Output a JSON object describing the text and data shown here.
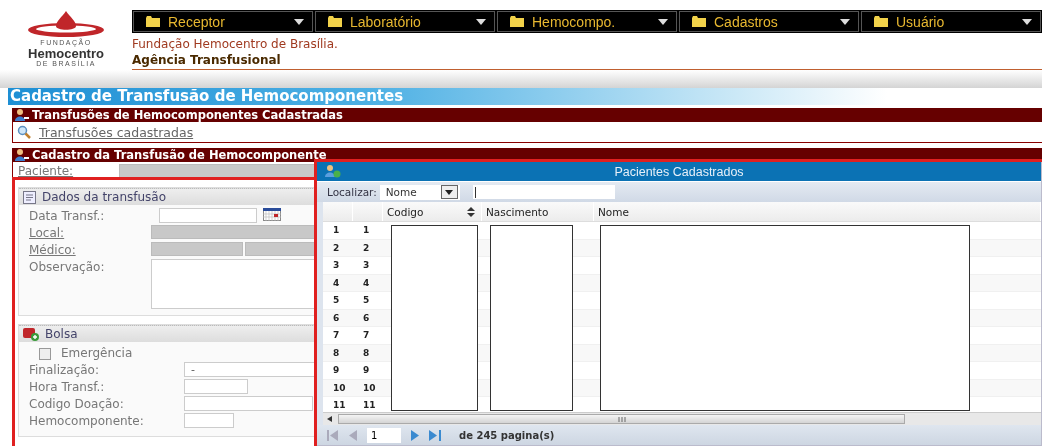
{
  "logo": {
    "top": "FUNDAÇÃO",
    "name": "Hemocentro",
    "bottom": "DE BRASÍLIA"
  },
  "menu": [
    {
      "label": "Receptor"
    },
    {
      "label": "Laboratório"
    },
    {
      "label": "Hemocompo."
    },
    {
      "label": "Cadastros"
    },
    {
      "label": "Usuário"
    }
  ],
  "org_name": "Fundação Hemocentro de Brasília.",
  "unit": "Agência Transfusional",
  "page_title": "Cadastro de Transfusão de Hemocomponentes",
  "list_section": {
    "title": "Transfusões de Hemocomponentes Cadastradas",
    "link": "Transfusões cadastradas"
  },
  "form_section": {
    "title": "Cadastro da Transfusão de Hemocomponente",
    "patient_label": "Paciente:",
    "groups": [
      {
        "title": "Dados da transfusão",
        "kind": "list",
        "fields": [
          {
            "kind": "date",
            "label": "Data Transf.:"
          },
          {
            "kind": "lookup",
            "label": "Local:"
          },
          {
            "kind": "lookup-split",
            "label": "Médico:"
          },
          {
            "kind": "textarea",
            "label": "Observação:"
          }
        ]
      },
      {
        "title": "Bolsa",
        "kind": "bag",
        "fields": [
          {
            "kind": "checkbox",
            "label": "Emergência",
            "checked": false
          },
          {
            "kind": "text",
            "label": "Finalização:",
            "value": "-"
          },
          {
            "kind": "text",
            "label": "Hora Transf.:"
          },
          {
            "kind": "text",
            "label": "Codigo Doação:"
          },
          {
            "kind": "text",
            "label": "Hemocomponente:"
          }
        ]
      }
    ]
  },
  "dialog": {
    "title": "Pacientes Cadastrados",
    "search_label": "Localizar:",
    "search_by": "Nome",
    "columns": [
      {
        "label": "Codigo",
        "sortable": true
      },
      {
        "label": "Nascimento",
        "sortable": false
      },
      {
        "label": "Nome",
        "sortable": false
      }
    ],
    "rows": [
      [
        "1",
        "1"
      ],
      [
        "2",
        "2"
      ],
      [
        "3",
        "3"
      ],
      [
        "4",
        "4"
      ],
      [
        "5",
        "5"
      ],
      [
        "6",
        "6"
      ],
      [
        "7",
        "7"
      ],
      [
        "8",
        "8"
      ],
      [
        "9",
        "9"
      ],
      [
        "10",
        "10"
      ],
      [
        "11",
        "11"
      ]
    ],
    "pager": {
      "page": "1",
      "total": "de 245 pagina(s)"
    }
  }
}
